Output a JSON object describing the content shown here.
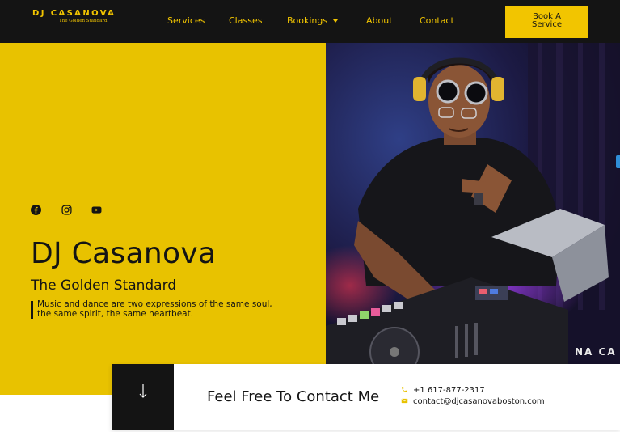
{
  "header": {
    "logo_main": "DJ CASANOVA",
    "logo_tagline": "The Golden Standard",
    "nav": [
      {
        "label": "Services"
      },
      {
        "label": "Classes"
      },
      {
        "label": "Bookings"
      },
      {
        "label": "About"
      },
      {
        "label": "Contact"
      }
    ],
    "book_button_line1": "Book A",
    "book_button_line2": "Service"
  },
  "hero": {
    "socials": [
      "facebook-icon",
      "instagram-icon",
      "youtube-icon"
    ],
    "title": "DJ Casanova",
    "subtitle": "The Golden Standard",
    "quote": "Music and dance are two expressions of the same soul, the same spirit, the same heartbeat.",
    "photo_text": "NA CA"
  },
  "contact": {
    "heading": "Feel Free To Contact Me",
    "phone": "+1 617-877-2317",
    "email": "contact@djcasanovaboston.com"
  },
  "colors": {
    "accent": "#f2c500",
    "hero_panel": "#e8c200",
    "dark": "#141414"
  }
}
